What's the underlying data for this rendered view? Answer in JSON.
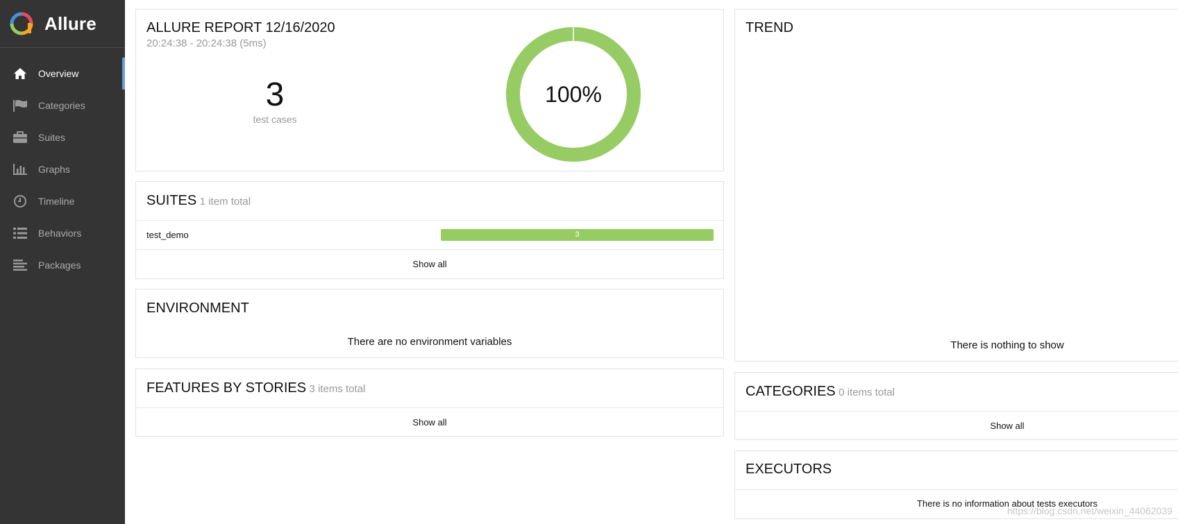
{
  "sidebar": {
    "brand": "Allure",
    "items": [
      {
        "label": "Overview",
        "icon": "home-icon",
        "active": true
      },
      {
        "label": "Categories",
        "icon": "flag-icon",
        "active": false
      },
      {
        "label": "Suites",
        "icon": "briefcase-icon",
        "active": false
      },
      {
        "label": "Graphs",
        "icon": "bar-chart-icon",
        "active": false
      },
      {
        "label": "Timeline",
        "icon": "clock-icon",
        "active": false
      },
      {
        "label": "Behaviors",
        "icon": "list-icon",
        "active": false
      },
      {
        "label": "Packages",
        "icon": "align-left-icon",
        "active": false
      }
    ]
  },
  "summary": {
    "title": "ALLURE REPORT 12/16/2020",
    "time": "20:24:38 - 20:24:38 (5ms)",
    "count": "3",
    "count_label": "test cases",
    "percent": "100%",
    "passed_fraction": 1.0,
    "pass_color": "#97cc64"
  },
  "suites": {
    "title": "SUITES",
    "subtitle": "1 item total",
    "rows": [
      {
        "name": "test_demo",
        "count": "3"
      }
    ],
    "show_all": "Show all"
  },
  "environment": {
    "title": "ENVIRONMENT",
    "empty": "There are no environment variables"
  },
  "features": {
    "title": "FEATURES BY STORIES",
    "subtitle": "3 items total",
    "show_all": "Show all"
  },
  "trend": {
    "title": "TREND",
    "empty": "There is nothing to show"
  },
  "categories": {
    "title": "CATEGORIES",
    "subtitle": "0 items total",
    "show_all": "Show all"
  },
  "executors": {
    "title": "EXECUTORS",
    "empty": "There is no information about tests executors"
  },
  "watermark": "https://blog.csdn.net/weixin_44062039"
}
